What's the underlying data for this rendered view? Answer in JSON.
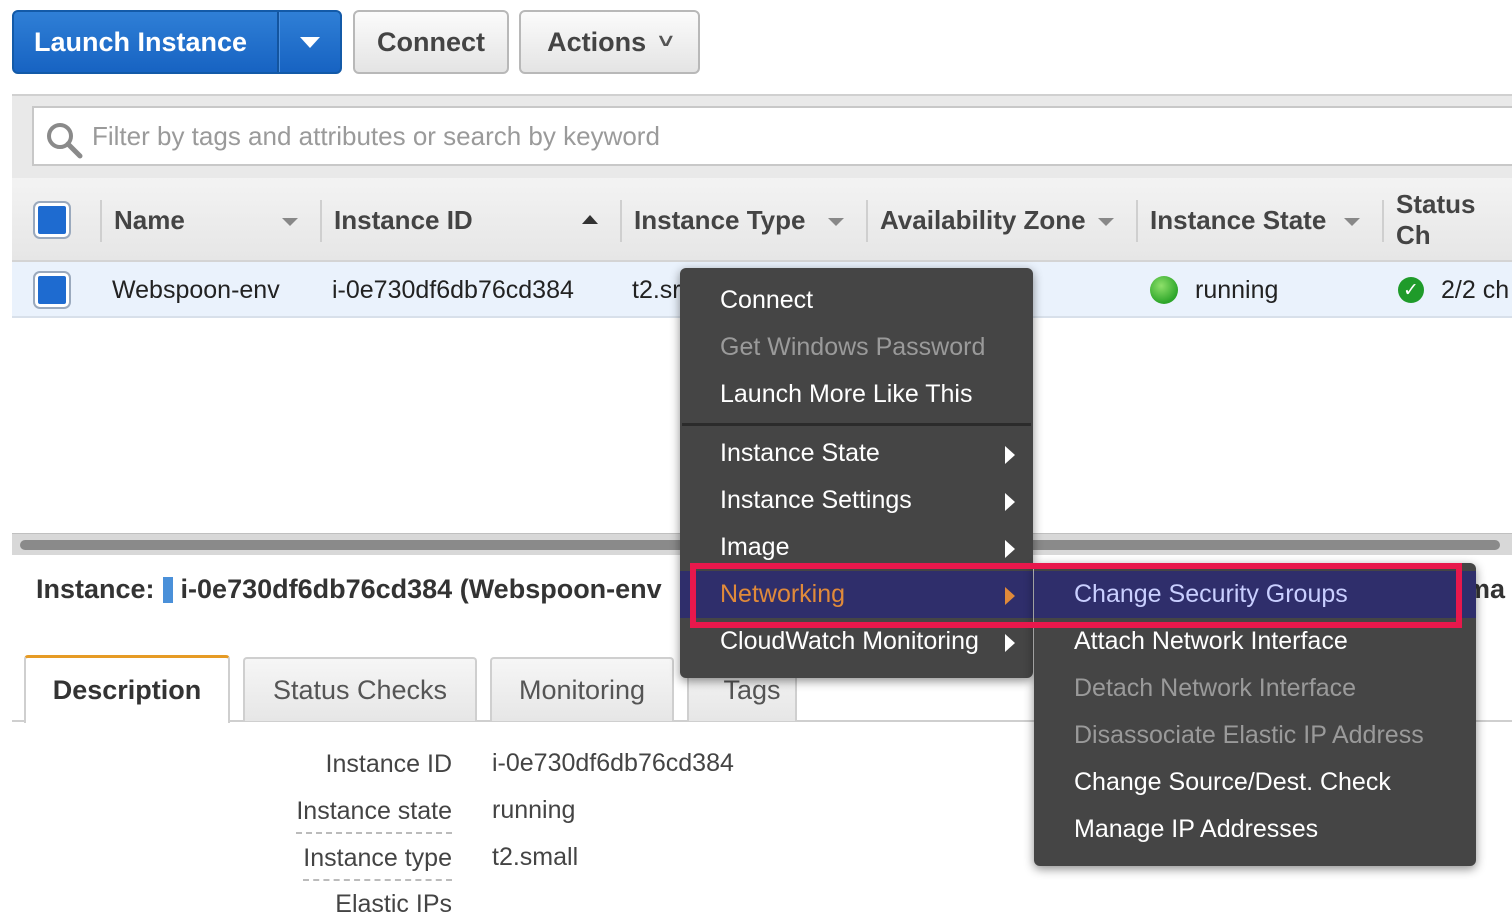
{
  "toolbar": {
    "launch_label": "Launch Instance",
    "connect_label": "Connect",
    "actions_label": "Actions",
    "actions_chevron": "˅"
  },
  "search": {
    "placeholder": "Filter by tags and attributes or search by keyword"
  },
  "table": {
    "headers": [
      "Name",
      "Instance ID",
      "Instance Type",
      "Availability Zone",
      "Instance State",
      "Status Ch"
    ],
    "rows": [
      {
        "name": "Webspoon-env",
        "instance_id": "i-0e730df6db76cd384",
        "instance_type": "t2.sr",
        "state": "running",
        "status_checks": "2/2 ch"
      }
    ]
  },
  "details": {
    "title_prefix": "Instance:",
    "title_value": "i-0e730df6db76cd384 (Webspoon-env",
    "title_trunc_right": "ma",
    "tabs": [
      "Description",
      "Status Checks",
      "Monitoring",
      "Tags"
    ],
    "fields": [
      {
        "label": "Instance ID",
        "value": "i-0e730df6db76cd384"
      },
      {
        "label": "Instance state",
        "value": "running"
      },
      {
        "label": "Instance type",
        "value": "t2.small"
      },
      {
        "label": "Elastic IPs",
        "value": ""
      }
    ]
  },
  "context_menu": {
    "items": [
      {
        "label": "Connect",
        "enabled": true
      },
      {
        "label": "Get Windows Password",
        "enabled": false
      },
      {
        "label": "Launch More Like This",
        "enabled": true
      },
      {
        "label": "Instance State",
        "enabled": true,
        "submenu": true
      },
      {
        "label": "Instance Settings",
        "enabled": true,
        "submenu": true
      },
      {
        "label": "Image",
        "enabled": true,
        "submenu": true
      },
      {
        "label": "Networking",
        "enabled": true,
        "submenu": true,
        "highlighted": true
      },
      {
        "label": "CloudWatch Monitoring",
        "enabled": true,
        "submenu": true
      }
    ]
  },
  "networking_submenu": {
    "items": [
      {
        "label": "Change Security Groups",
        "enabled": true,
        "highlighted": true
      },
      {
        "label": "Attach Network Interface",
        "enabled": true
      },
      {
        "label": "Detach Network Interface",
        "enabled": false
      },
      {
        "label": "Disassociate Elastic IP Address",
        "enabled": false
      },
      {
        "label": "Change Source/Dest. Check",
        "enabled": true
      },
      {
        "label": "Manage IP Addresses",
        "enabled": true
      }
    ]
  },
  "colors": {
    "primary_button": "#1763c2",
    "menu_bg": "#454545",
    "menu_highlight": "#2f2e6b",
    "annotation": "#e8184c",
    "running_dot": "#2da62a",
    "active_tab_accent": "#e69b25"
  }
}
